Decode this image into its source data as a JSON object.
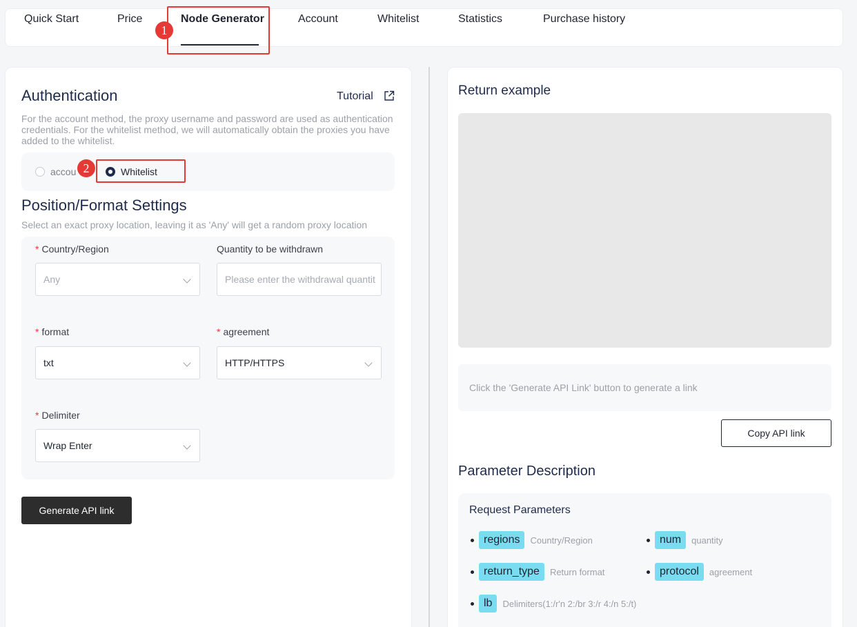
{
  "tabs": [
    {
      "label": "Quick Start"
    },
    {
      "label": "Price"
    },
    {
      "label": "Node Generator"
    },
    {
      "label": "Account"
    },
    {
      "label": "Whitelist"
    },
    {
      "label": "Statistics"
    },
    {
      "label": "Purchase history"
    }
  ],
  "annotations": {
    "one": "1",
    "two": "2"
  },
  "auth": {
    "title": "Authentication",
    "tutorial": "Tutorial",
    "description_line1": "For the account method, the proxy username and password are used as authentication",
    "description_line2": "credentials. For the whitelist method, we will automatically obtain the proxies you have",
    "description_line3": "added to the whitelist.",
    "option_account": "accou",
    "option_whitelist": "Whitelist"
  },
  "settings": {
    "title": "Position/Format Settings",
    "description": "Select an exact proxy location, leaving it as 'Any' will get a random proxy location",
    "country_label": "Country/Region",
    "country_value": "Any",
    "quantity_label": "Quantity to be withdrawn",
    "quantity_placeholder": "Please enter the withdrawal quantit",
    "format_label": "format",
    "format_value": "txt",
    "agreement_label": "agreement",
    "agreement_value": "HTTP/HTTPS",
    "delimiter_label": "Delimiter",
    "delimiter_value": "Wrap Enter",
    "required_mark": "*"
  },
  "generate_button": "Generate API link",
  "right": {
    "return_title": "Return example",
    "link_hint": "Click the 'Generate API Link' button to generate a link",
    "copy_button": "Copy API link",
    "param_title": "Parameter Description",
    "request_title": "Request Parameters",
    "params": [
      {
        "name": "regions",
        "desc": "Country/Region"
      },
      {
        "name": "num",
        "desc": "quantity"
      },
      {
        "name": "return_type",
        "desc": "Return format"
      },
      {
        "name": "protocol",
        "desc": "agreement"
      },
      {
        "name": "lb",
        "desc": "Delimiters(1:/r'n 2:/br 3:/r 4:/n 5:/t)"
      }
    ]
  },
  "colors": {
    "annotation": "#e53935",
    "tag": "#79dcf0",
    "heading": "#1f2b4a"
  }
}
